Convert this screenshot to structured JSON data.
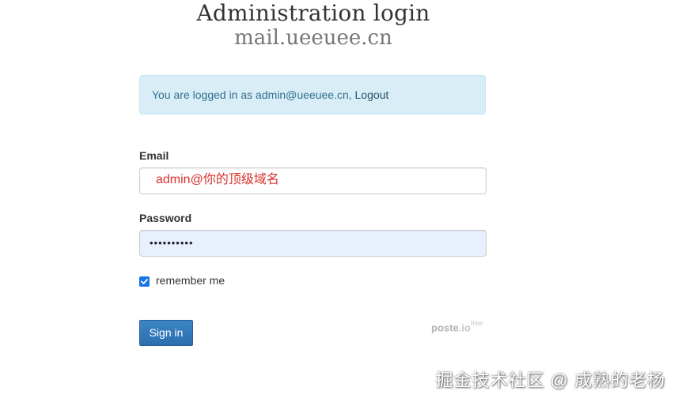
{
  "header": {
    "title": "Administration login",
    "subtitle": "mail.ueeuee.cn"
  },
  "alert": {
    "message": "You are logged in as admin@ueeuee.cn,",
    "logout_link": "Logout",
    "bg_color": "#d9edf7",
    "text_color": "#31708f"
  },
  "form": {
    "email_label": "Email",
    "email_value": "admin@你的顶级域名",
    "password_label": "Password",
    "password_value": "••••••••••",
    "remember_label": "remember me",
    "remember_checked": true,
    "submit_label": "Sign in",
    "submit_color": "#337ab7"
  },
  "brand": {
    "name": "poste",
    "tld": ".io",
    "edition": "free"
  },
  "watermark": {
    "text": "掘金技术社区 @ 成熟的老杨"
  }
}
